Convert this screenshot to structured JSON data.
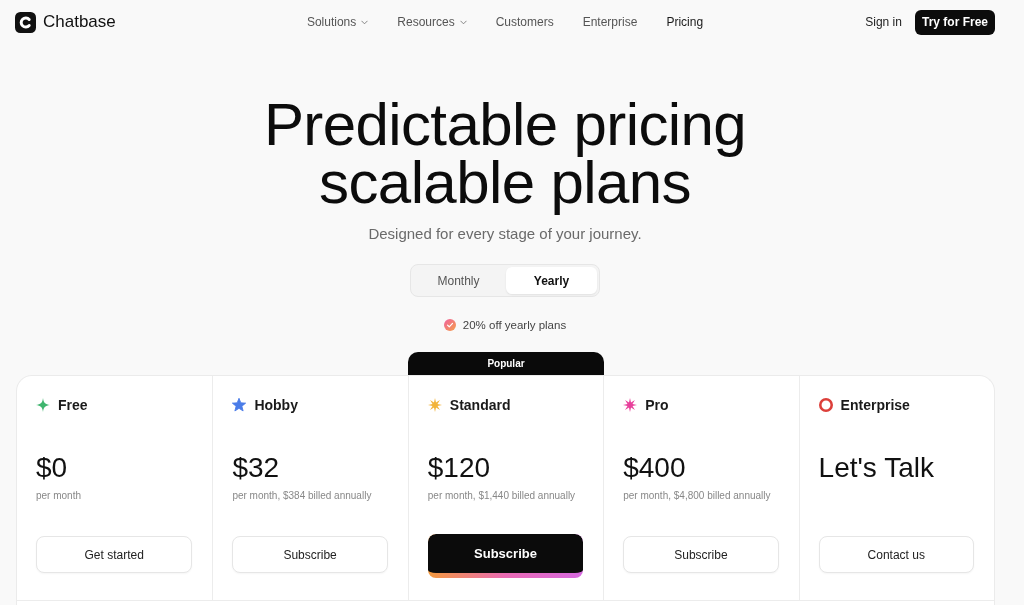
{
  "logo": {
    "text": "Chatbase"
  },
  "nav": {
    "links": [
      {
        "label": "Solutions",
        "dropdown": true,
        "selected": false
      },
      {
        "label": "Resources",
        "dropdown": true,
        "selected": false
      },
      {
        "label": "Customers",
        "dropdown": false,
        "selected": false
      },
      {
        "label": "Enterprise",
        "dropdown": false,
        "selected": false
      },
      {
        "label": "Pricing",
        "dropdown": false,
        "selected": true
      }
    ]
  },
  "header_actions": {
    "sign_in": "Sign in",
    "cta": "Try for Free"
  },
  "hero": {
    "title": "Predictable pricing scalable plans",
    "subtitle": "Designed for every stage of your journey."
  },
  "billing_toggle": {
    "options": [
      {
        "label": "Monthly",
        "selected": false
      },
      {
        "label": "Yearly",
        "selected": true
      }
    ]
  },
  "discount_note": "20% off yearly plans",
  "plans": [
    {
      "name": "Free",
      "kind": "sparkle",
      "color": "#3fb56e",
      "price": "$0",
      "price_note": "per month",
      "button": "Get started",
      "featured": false
    },
    {
      "name": "Hobby",
      "kind": "star",
      "color": "#4a7ce8",
      "price": "$32",
      "price_note": "per month, $384 billed annually",
      "button": "Subscribe",
      "featured": false
    },
    {
      "name": "Standard",
      "kind": "burst",
      "color": "#f2b43a",
      "badge": "Popular",
      "price": "$120",
      "price_note": "per month, $1,440 billed annually",
      "button": "Subscribe",
      "featured": true
    },
    {
      "name": "Pro",
      "kind": "burst",
      "color": "#e8409b",
      "price": "$400",
      "price_note": "per month, $4,800 billed annually",
      "button": "Subscribe",
      "featured": false
    },
    {
      "name": "Enterprise",
      "kind": "ring",
      "color": "#dc3f3a",
      "price": "Let's Talk",
      "button": "Contact us",
      "featured": false
    }
  ]
}
